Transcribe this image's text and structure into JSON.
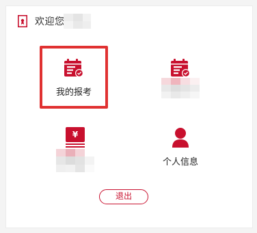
{
  "header": {
    "welcome_text": "欢迎您"
  },
  "menu": {
    "items": [
      {
        "label": "我的报考",
        "icon": "calendar-check-icon"
      },
      {
        "label": "",
        "icon": "calendar-check-icon"
      },
      {
        "label": "",
        "icon": "yuan-bill-icon"
      },
      {
        "label": "个人信息",
        "icon": "user-icon"
      }
    ]
  },
  "actions": {
    "logout_label": "退出"
  },
  "colors": {
    "accent": "#c8102e",
    "highlight": "#e03131",
    "text": "#333333"
  }
}
